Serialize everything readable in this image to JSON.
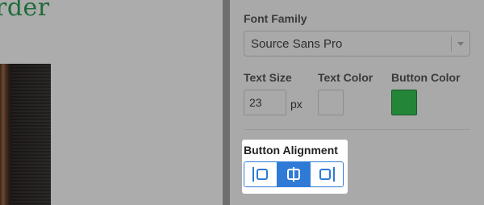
{
  "preview": {
    "heading_fragment": "rder"
  },
  "panel": {
    "font_family": {
      "label": "Font Family",
      "value": "Source Sans Pro"
    },
    "text_size": {
      "label": "Text Size",
      "value": "23",
      "unit": "px"
    },
    "text_color": {
      "label": "Text Color",
      "color": "#a9a9a9"
    },
    "button_color": {
      "label": "Button Color",
      "color": "#238636"
    },
    "button_alignment": {
      "label": "Button Alignment",
      "options": [
        {
          "name": "left",
          "icon": "align-left-icon",
          "active": false
        },
        {
          "name": "center",
          "icon": "align-center-icon",
          "active": true
        },
        {
          "name": "right",
          "icon": "align-right-icon",
          "active": false
        }
      ],
      "accent": "#2f7ad6"
    }
  }
}
